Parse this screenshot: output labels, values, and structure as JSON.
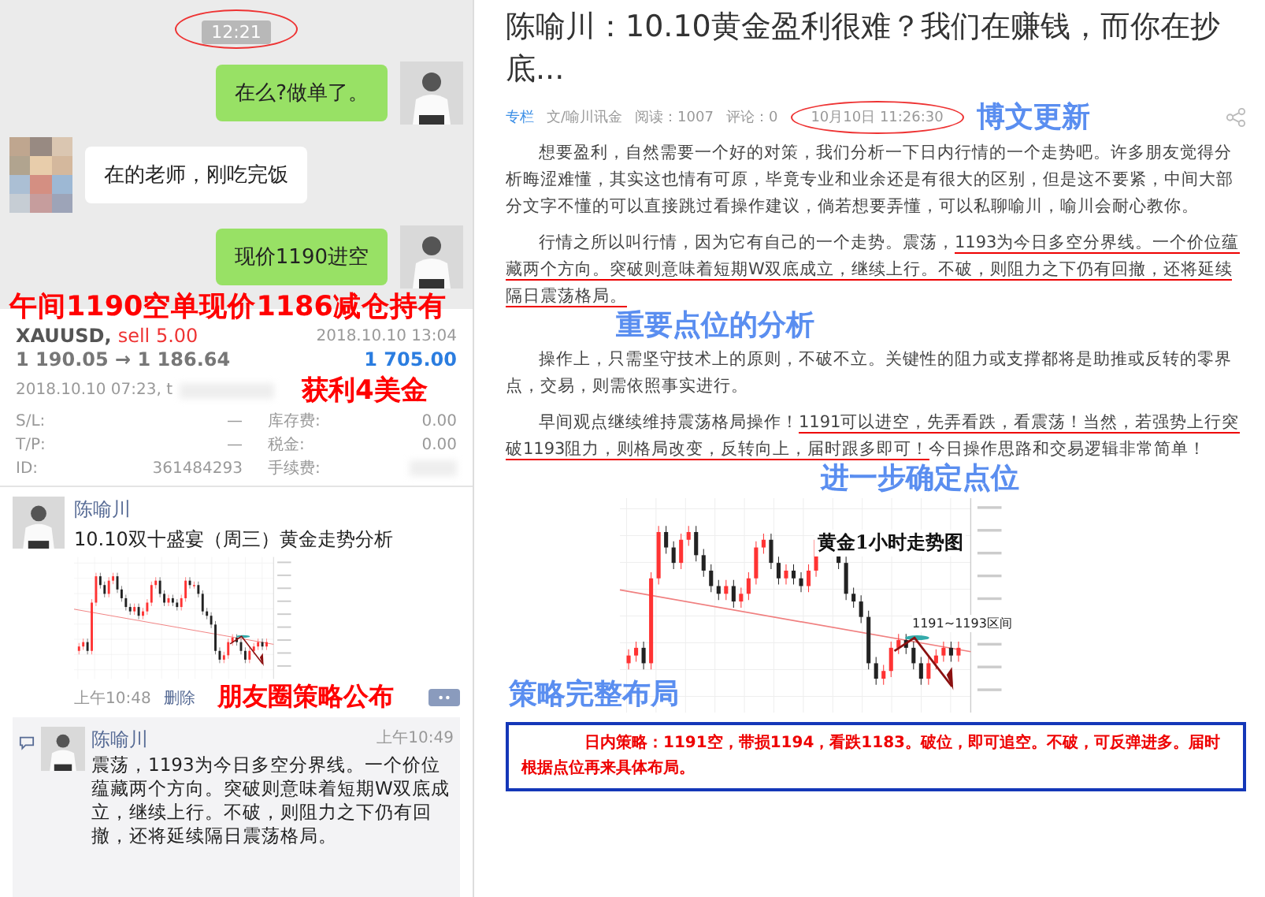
{
  "chat": {
    "time": "12:21",
    "messages": [
      {
        "outgoing": true,
        "text": "在么?做单了。"
      },
      {
        "outgoing": false,
        "text": "在的老师，刚吃完饭"
      },
      {
        "outgoing": true,
        "text": "现价1190进空"
      }
    ]
  },
  "trade_note": "午间1190空单现价1186减仓持有",
  "trade": {
    "symbol": "XAUUSD,",
    "side": "sell 5.00",
    "close_time": "2018.10.10 13:04",
    "prices": "1 190.05 → 1 186.64",
    "profit": "1 705.00",
    "open_time": "2018.10.10 07:23, t",
    "profit_note": "获利4美金",
    "fields": [
      {
        "label": "S/L:",
        "value": "—",
        "label2": "库存费:",
        "value2": "0.00",
        "blurred": false
      },
      {
        "label": "T/P:",
        "value": "—",
        "label2": "税金:",
        "value2": "0.00",
        "blurred": false
      },
      {
        "label": "ID:",
        "value": "361484293",
        "label2": "手续费:",
        "blurred": true
      }
    ]
  },
  "moment": {
    "author": "陈喻川",
    "title": "10.10双十盛宴（周三）黄金走势分析",
    "time": "上午10:48",
    "delete": "删除",
    "note": "朋友圈策略公布",
    "comment": {
      "author": "陈喻川",
      "time": "上午10:49",
      "text": "震荡，1193为今日多空分界线。一个价位蕴藏两个方向。突破则意味着短期W双底成立，继续上行。不破，则阻力之下仍有回撤，还将延续隔日震荡格局。"
    }
  },
  "article": {
    "title": "陈喻川：10.10黄金盈利很难？我们在赚钱，而你在抄底...",
    "meta": {
      "column": "专栏",
      "author": "文/喻川讯金",
      "reads": "阅读：1007",
      "comments": "评论：0",
      "date": "10月10日 11:26:30"
    },
    "update_note": "博文更新",
    "paragraphs": [
      {
        "segments": [
          {
            "text": "想要盈利，自然需要一个好的对策，我们分析一下日内行情的一个走势吧。许多朋友觉得分析晦涩难懂，其实这也情有可原，毕竟专业和业余还是有很大的区别，但是这不要紧，中间大部分文字不懂的可以直接跳过看操作建议，倘若想要弄懂，可以私聊喻川，喻川会耐心教你。",
            "underlined": false
          }
        ]
      },
      {
        "segments": [
          {
            "text": "行情之所以叫行情，因为它有自己的一个走势。震荡，",
            "underlined": false
          },
          {
            "text": "1193为今日多空分界线。一个价位蕴藏两个方向。突破则意味着短期W双底成立，继续上行。不破，则阻力之下仍有回撤，还将延续隔日震荡格局。",
            "underlined": true
          }
        ],
        "note": "重要点位的分析"
      },
      {
        "segments": [
          {
            "text": "操作上，只需坚守技术上的原则，不破不立。关键性的阻力或支撑都将是助推或反转的零界点，交易，则需依照事实进行。",
            "underlined": false
          }
        ]
      },
      {
        "segments": [
          {
            "text": "早间观点继续维持震荡格局操作！",
            "underlined": false
          },
          {
            "text": "1191可以进空，先弄看跌，看震荡！当然，若强势上行突破1193阻力，则格局改变，反转向上，届时跟多即可！",
            "underlined": true
          },
          {
            "text": "今日操作思路和交易逻辑非常简单！",
            "underlined": false
          }
        ],
        "note": "进一步确定点位"
      }
    ],
    "chart": {
      "title": "黄金1小时走势图",
      "zone": "1191~1193区间"
    },
    "layout_note": "策略完整布局",
    "strategy": "日内策略：1191空，带损1194，看跌1183。破位，即可追空。不破，可反弹进多。届时根据点位再来具体布局。"
  }
}
